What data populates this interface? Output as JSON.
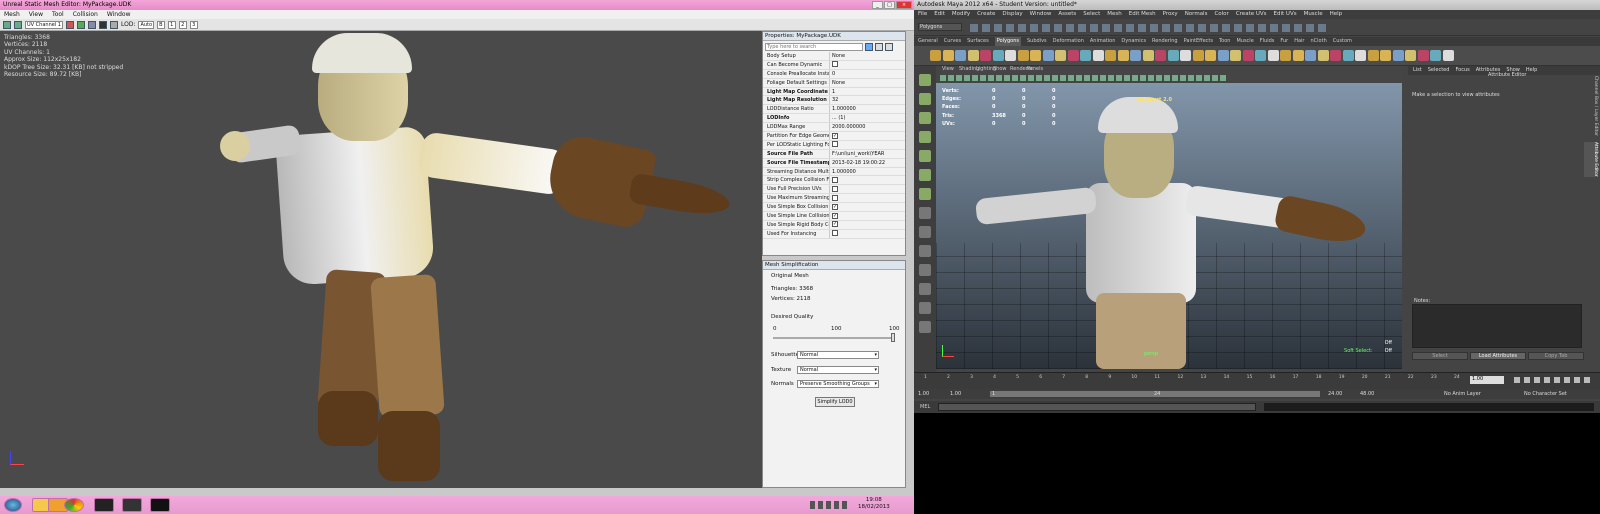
{
  "udk": {
    "title": "Unreal Static Mesh Editor: MyPackage.UDK",
    "menu": [
      "Mesh",
      "View",
      "Tool",
      "Collision",
      "Window"
    ],
    "toolbar": {
      "uv_channel": "UV Channel 1",
      "lod_label": "LOD:",
      "lod_auto": "Auto",
      "b_label": "B",
      "lod1": "1",
      "lod2": "2",
      "lod3": "3"
    },
    "stats": [
      "Triangles: 3368",
      "Vertices: 2118",
      "UV Channels: 1",
      "Approx Size: 112x25x182",
      "kDOP Tree Size: 32.31 [KB] not stripped",
      "Resource Size: 89.72 [KB]"
    ],
    "properties": {
      "title": "Properties: MyPackage.UDK",
      "search_placeholder": "Type here to search",
      "rows": [
        {
          "key": "Body Setup",
          "value": "None",
          "type": "text"
        },
        {
          "key": "Can Become Dynamic",
          "value": "",
          "type": "check",
          "checked": false
        },
        {
          "key": "Console Preallocate Instanc",
          "value": "0",
          "type": "text"
        },
        {
          "key": "Foliage Default Settings",
          "value": "None",
          "type": "text"
        },
        {
          "key": "Light Map Coordinate In",
          "value": "1",
          "type": "text",
          "bold": true
        },
        {
          "key": "Light Map Resolution",
          "value": "32",
          "type": "text",
          "bold": true
        },
        {
          "key": "LODDistance Ratio",
          "value": "1.000000",
          "type": "text"
        },
        {
          "key": "LODInfo",
          "value": "... (1)",
          "type": "text",
          "bold": true
        },
        {
          "key": "LODMax Range",
          "value": "2000.000000",
          "type": "text"
        },
        {
          "key": "Partition For Edge Geomet",
          "value": "",
          "type": "check",
          "checked": true
        },
        {
          "key": "Per LODStatic Lighting For",
          "value": "",
          "type": "check",
          "checked": false
        },
        {
          "key": "Source File Path",
          "value": "F:\\uni\\uni_work\\YEAR",
          "type": "text",
          "bold": true
        },
        {
          "key": "Source File Timestamp",
          "value": "2013-02-18 19:00:22",
          "type": "text",
          "bold": true
        },
        {
          "key": "Streaming Distance Multiplie",
          "value": "1.000000",
          "type": "text"
        },
        {
          "key": "Strip Complex Collision For C",
          "value": "",
          "type": "check",
          "checked": false
        },
        {
          "key": "Use Full Precision UVs",
          "value": "",
          "type": "check",
          "checked": false
        },
        {
          "key": "Use Maximum Streaming Te",
          "value": "",
          "type": "check",
          "checked": false
        },
        {
          "key": "Use Simple Box Collision",
          "value": "",
          "type": "check",
          "checked": true
        },
        {
          "key": "Use Simple Line Collision",
          "value": "",
          "type": "check",
          "checked": true
        },
        {
          "key": "Use Simple Rigid Body Collis",
          "value": "",
          "type": "check",
          "checked": true
        },
        {
          "key": "Used For Instancing",
          "value": "",
          "type": "check",
          "checked": false
        }
      ]
    },
    "simplification": {
      "title": "Mesh Simplification",
      "original": "Original Mesh",
      "triangles": "Triangles: 3368",
      "vertices": "Vertices: 2118",
      "desired_quality": "Desired Quality",
      "scale_min": "0",
      "scale_mid": "100",
      "scale_max": "100",
      "quality_value": 1.0,
      "silhouette_label": "Silhouette",
      "silhouette_value": "Normal",
      "texture_label": "Texture",
      "texture_value": "Normal",
      "normals_label": "Normals",
      "normals_value": "Preserve Smoothing Groups",
      "button": "Simplify LOD0"
    }
  },
  "maya": {
    "title": "Autodesk Maya 2012 x64 - Student Version: untitled*",
    "menu": [
      "File",
      "Edit",
      "Modify",
      "Create",
      "Display",
      "Window",
      "Assets",
      "Select",
      "Mesh",
      "Edit Mesh",
      "Proxy",
      "Normals",
      "Color",
      "Create UVs",
      "Edit UVs",
      "Muscle",
      "Help"
    ],
    "mode": "Polygons",
    "shelf_tabs": [
      "General",
      "Curves",
      "Surfaces",
      "Polygons",
      "Subdivs",
      "Deformation",
      "Animation",
      "Dynamics",
      "Rendering",
      "PaintEffects",
      "Toon",
      "Muscle",
      "Fluids",
      "Fur",
      "Hair",
      "nCloth",
      "Custom"
    ],
    "active_shelf": "Polygons",
    "viewport_menu": [
      "View",
      "Shading",
      "Lighting",
      "Show",
      "Renderer",
      "Panels"
    ],
    "hud": [
      {
        "label": "Verts:",
        "vals": [
          "0",
          "0",
          "0"
        ]
      },
      {
        "label": "Edges:",
        "vals": [
          "0",
          "0",
          "0"
        ]
      },
      {
        "label": "Faces:",
        "vals": [
          "0",
          "0",
          "0"
        ]
      },
      {
        "label": "Tris:",
        "vals": [
          "3368",
          "0",
          "0"
        ]
      },
      {
        "label": "UVs:",
        "vals": [
          "0",
          "0",
          "0"
        ]
      }
    ],
    "viewport_label": "Viewport 2.0",
    "hud_right": [
      {
        "label": "",
        "val": "Off"
      },
      {
        "label": "Soft Select:",
        "val": "Off"
      }
    ],
    "camera": "persp",
    "attr": {
      "menu": [
        "List",
        "Selected",
        "Focus",
        "Attributes",
        "Show",
        "Help"
      ],
      "title": "Attribute Editor",
      "message": "Make a selection to view attributes",
      "notes": "Notes:",
      "select": "Select",
      "load": "Load Attributes",
      "copy": "Copy Tab"
    },
    "side_tabs": [
      "Channel Box / Layer Editor",
      "Attribute Editor"
    ],
    "timeline_ticks": [
      "1",
      "2",
      "3",
      "4",
      "5",
      "6",
      "7",
      "8",
      "9",
      "10",
      "11",
      "12",
      "13",
      "14",
      "15",
      "16",
      "17",
      "18",
      "19",
      "20",
      "21",
      "22",
      "23",
      "24"
    ],
    "current_frame": "1.00",
    "range": {
      "start": "1.00",
      "start2": "1.00",
      "handle_start": "1",
      "handle_end": "24",
      "end": "24.00",
      "end2": "48.00",
      "anim_layer": "No Anim Layer",
      "char_set": "No Character Set"
    },
    "cmd_label": "MEL"
  },
  "taskbar": {
    "time": "19:08",
    "date": "18/02/2013"
  }
}
